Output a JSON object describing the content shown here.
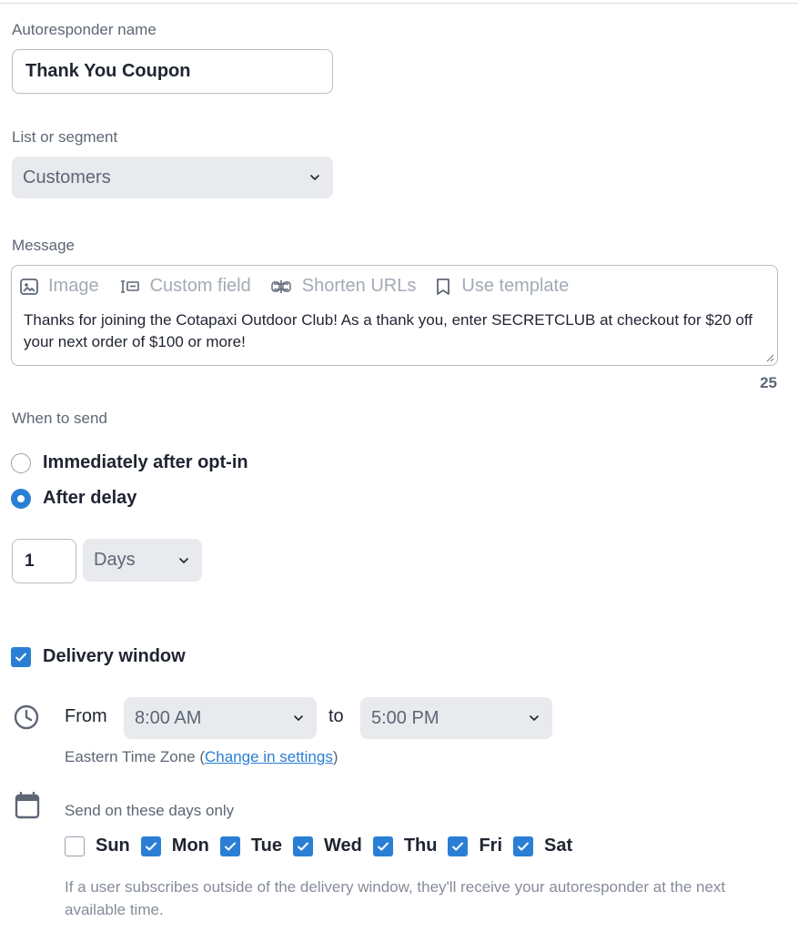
{
  "autoresponder": {
    "label": "Autoresponder name",
    "value": "Thank You Coupon"
  },
  "list": {
    "label": "List or segment",
    "value": "Customers"
  },
  "message": {
    "label": "Message",
    "toolbar": {
      "image": "Image",
      "custom_field": "Custom field",
      "shorten_urls": "Shorten URLs",
      "use_template": "Use template"
    },
    "text": "Thanks for joining the Cotapaxi Outdoor Club! As a thank you, enter SECRETCLUB at checkout for $20 off your next order of $100 or more!",
    "char_count": "25"
  },
  "when_to_send": {
    "label": "When to send",
    "options": [
      {
        "label": "Immediately after opt-in",
        "selected": false
      },
      {
        "label": "After delay",
        "selected": true
      }
    ],
    "delay_value": "1",
    "delay_unit": "Days"
  },
  "delivery_window": {
    "label": "Delivery window",
    "checked": true,
    "from_label": "From",
    "from_value": "8:00 AM",
    "to_label": "to",
    "to_value": "5:00 PM",
    "timezone_prefix": "Eastern Time Zone (",
    "timezone_link": "Change in settings",
    "timezone_suffix": ")",
    "days_label": "Send on these days only",
    "days": [
      {
        "label": "Sun",
        "checked": false
      },
      {
        "label": "Mon",
        "checked": true
      },
      {
        "label": "Tue",
        "checked": true
      },
      {
        "label": "Wed",
        "checked": true
      },
      {
        "label": "Thu",
        "checked": true
      },
      {
        "label": "Fri",
        "checked": true
      },
      {
        "label": "Sat",
        "checked": true
      }
    ],
    "footnote": "If a user subscribes outside of the delivery window, they'll receive your autoresponder at the next available time."
  },
  "colors": {
    "accent": "#2a7fd4",
    "select_bg": "#e8eaee",
    "muted_text": "#5d6675"
  },
  "icons": {
    "select": "chevron-down-icon",
    "time": "clock-icon",
    "days": "calendar-icon",
    "check": "check-icon"
  }
}
